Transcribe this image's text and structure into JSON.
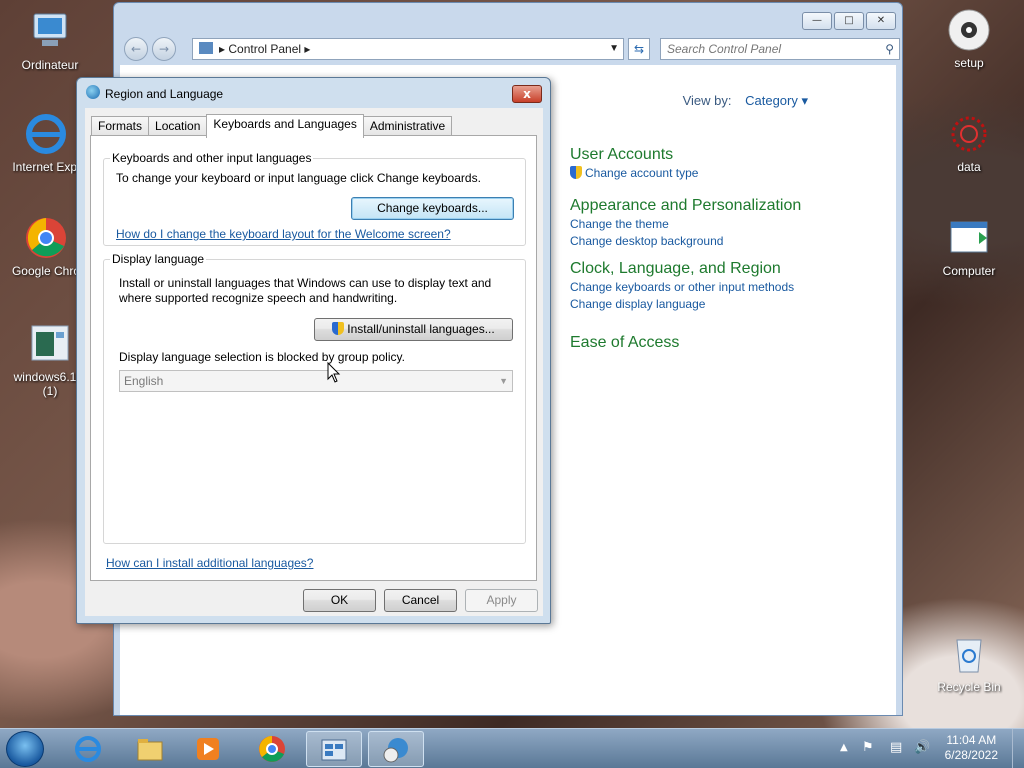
{
  "desktop": {
    "icons": [
      {
        "label": "Ordinateur"
      },
      {
        "label": "Internet Expl"
      },
      {
        "label": "Google Chro"
      },
      {
        "label": "windows6.1-k (1)"
      },
      {
        "label": "setup"
      },
      {
        "label": "data"
      },
      {
        "label": "Computer"
      },
      {
        "label": "Recycle Bin"
      }
    ]
  },
  "control_panel": {
    "address": "Control Panel",
    "search_placeholder": "Search Control Panel",
    "view_by_label": "View by:",
    "view_by_value": "Category",
    "categories": [
      {
        "title": "User Accounts",
        "links": [
          "Change account type"
        ]
      },
      {
        "title": "Appearance and Personalization",
        "links": [
          "Change the theme",
          "Change desktop background"
        ]
      },
      {
        "title": "Clock, Language, and Region",
        "links": [
          "Change keyboards or other input methods",
          "Change display language"
        ]
      },
      {
        "title": "Ease of Access",
        "links": []
      }
    ]
  },
  "dialog": {
    "title": "Region and Language",
    "close": "x",
    "tabs": [
      "Formats",
      "Location",
      "Keyboards and Languages",
      "Administrative"
    ],
    "active_tab": "Keyboards and Languages",
    "keyboards_group": {
      "title": "Keyboards and other input languages",
      "desc": "To change your keyboard or input language click Change keyboards.",
      "button": "Change keyboards...",
      "link": "How do I change the keyboard layout for the Welcome screen?"
    },
    "display_group": {
      "title": "Display language",
      "desc_line1": "Install or uninstall languages that Windows can use to display text and",
      "desc_line2": "where supported recognize speech and handwriting.",
      "button": "Install/uninstall languages...",
      "blocked": "Display language selection is blocked by group policy.",
      "selected_language": "English"
    },
    "bottom_link": "How can I install additional languages?",
    "ok": "OK",
    "cancel": "Cancel",
    "apply": "Apply"
  },
  "taskbar": {
    "time": "11:04 AM",
    "date": "6/28/2022"
  },
  "colors": {
    "link": "#1a5aa0",
    "category_title": "#1e7a2e",
    "taskbar": "#5a7896"
  }
}
